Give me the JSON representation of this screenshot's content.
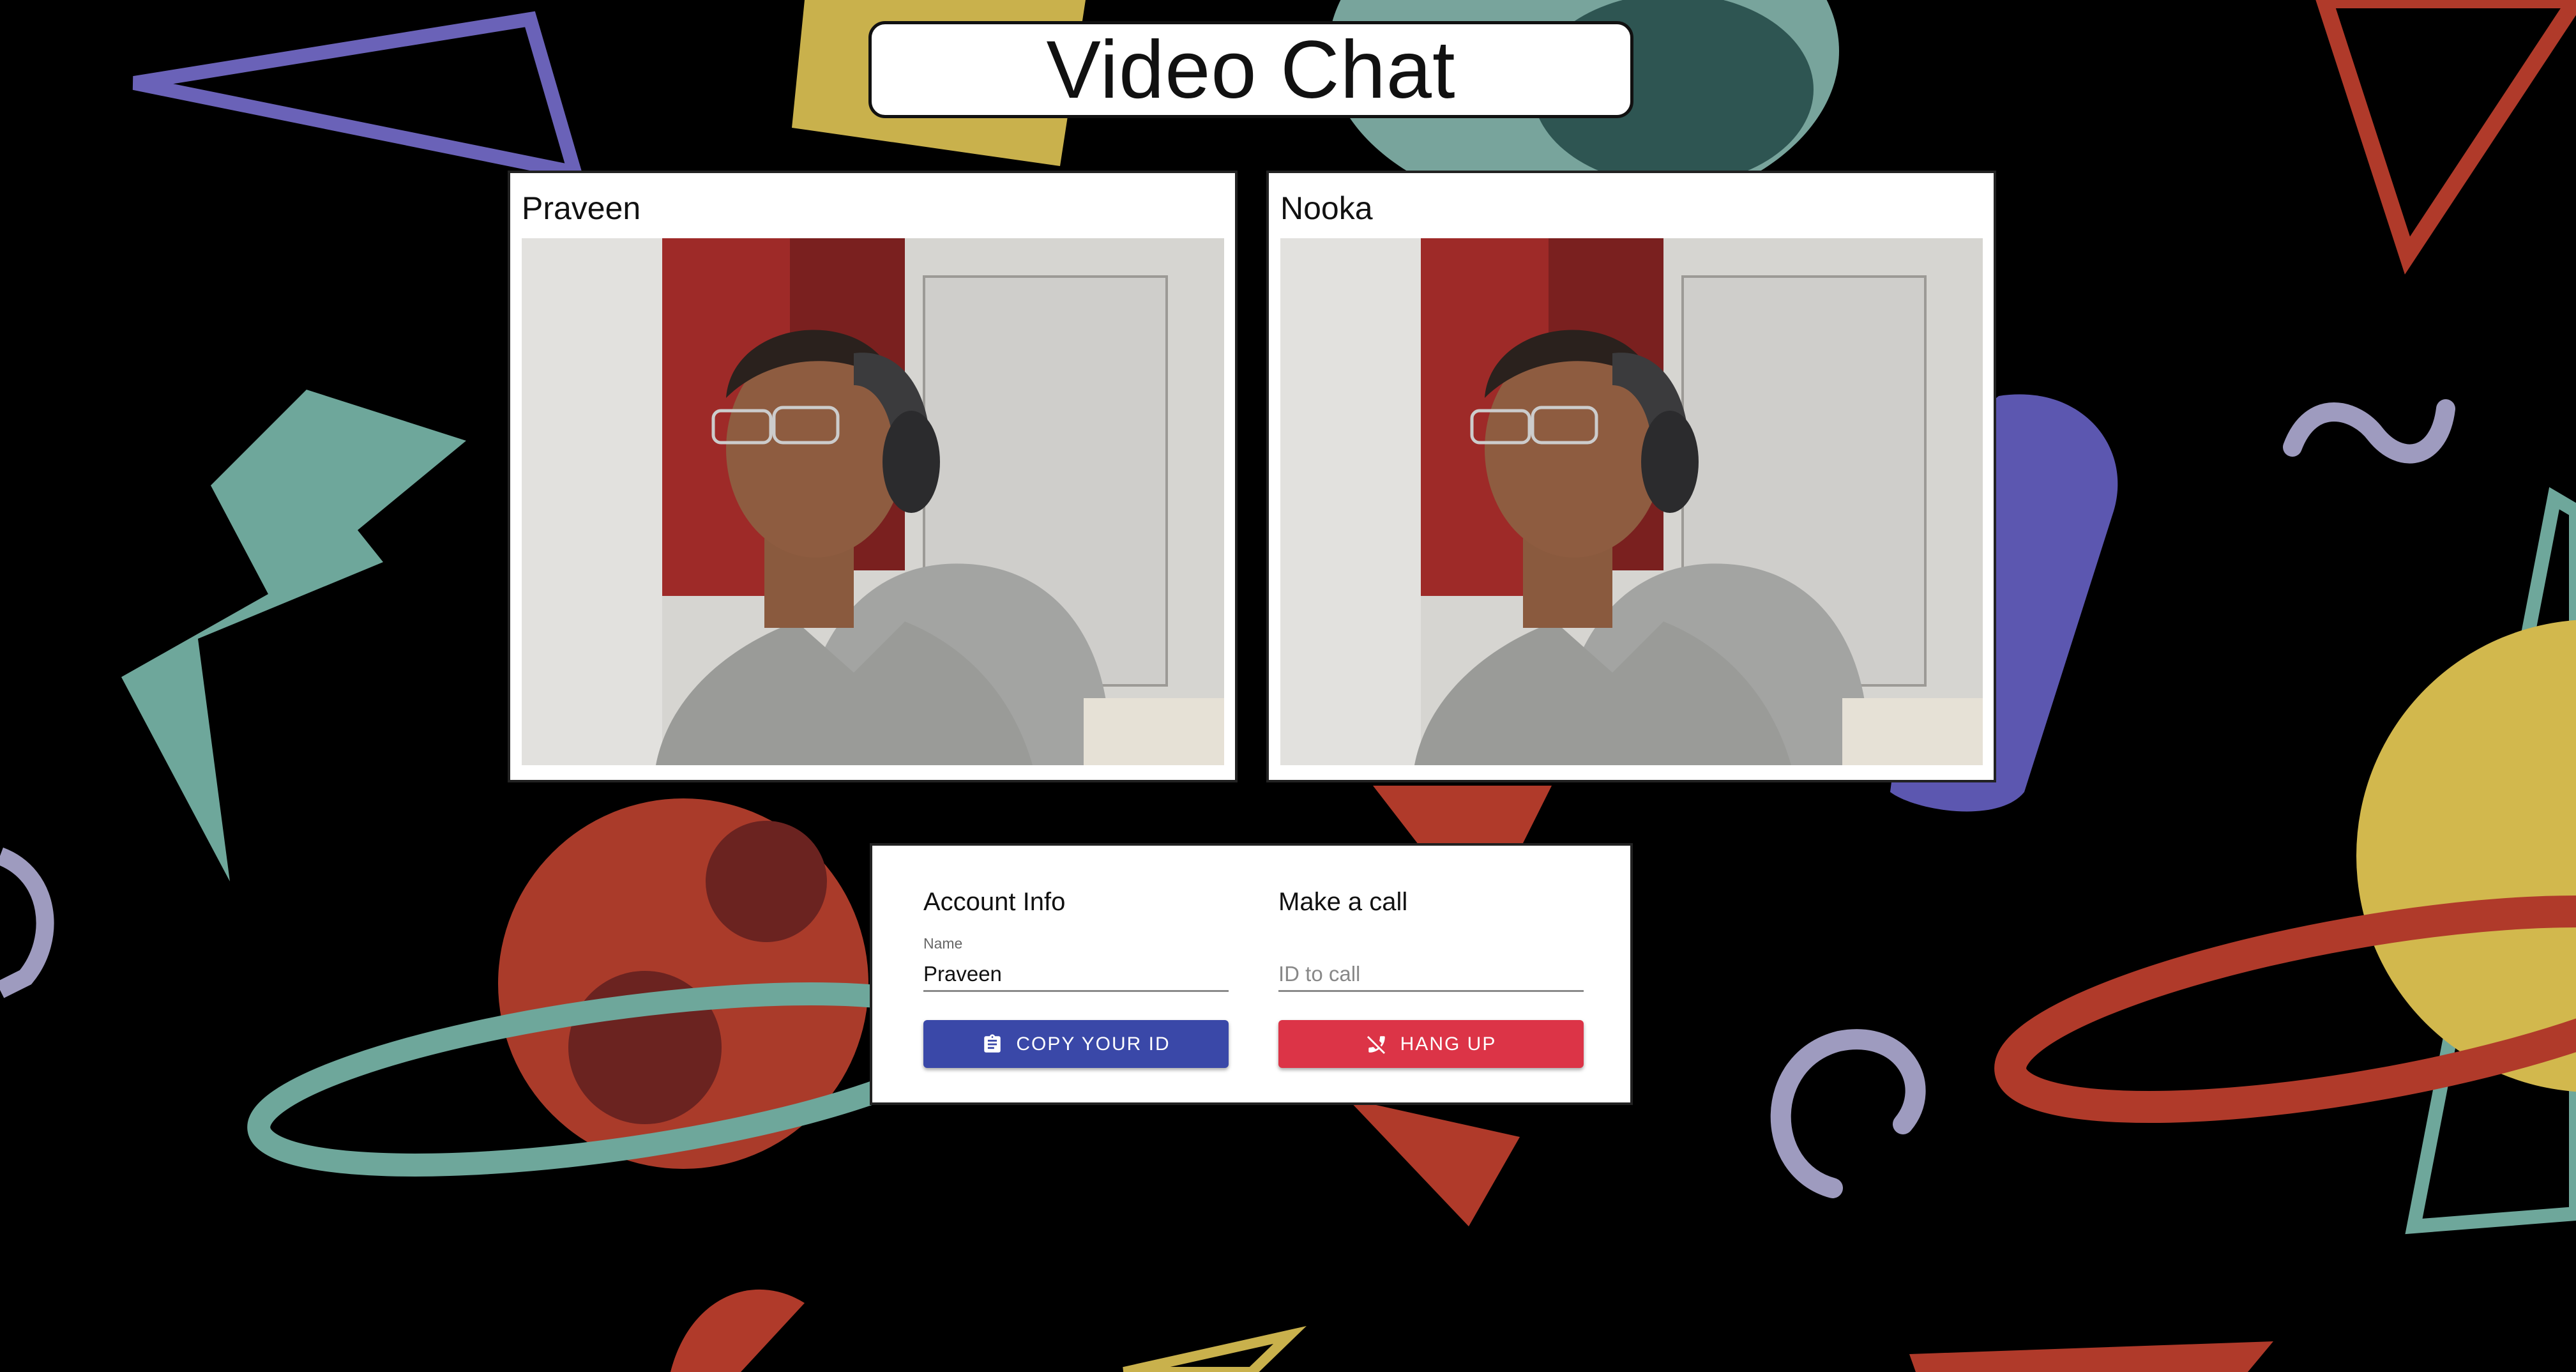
{
  "app": {
    "title": "Video Chat"
  },
  "videos": [
    {
      "name": "Praveen"
    },
    {
      "name": "Nooka"
    }
  ],
  "options": {
    "account": {
      "heading": "Account Info",
      "name_label": "Name",
      "name_value": "Praveen",
      "copy_button": "COPY YOUR ID",
      "copy_icon": "clipboard-icon"
    },
    "call": {
      "heading": "Make a call",
      "id_placeholder": "ID to call",
      "hangup_button": "HANG UP",
      "hangup_icon": "phone-disabled-icon"
    }
  },
  "colors": {
    "primary": "#3a48a8",
    "danger": "#dc3447",
    "background": "#000000"
  }
}
